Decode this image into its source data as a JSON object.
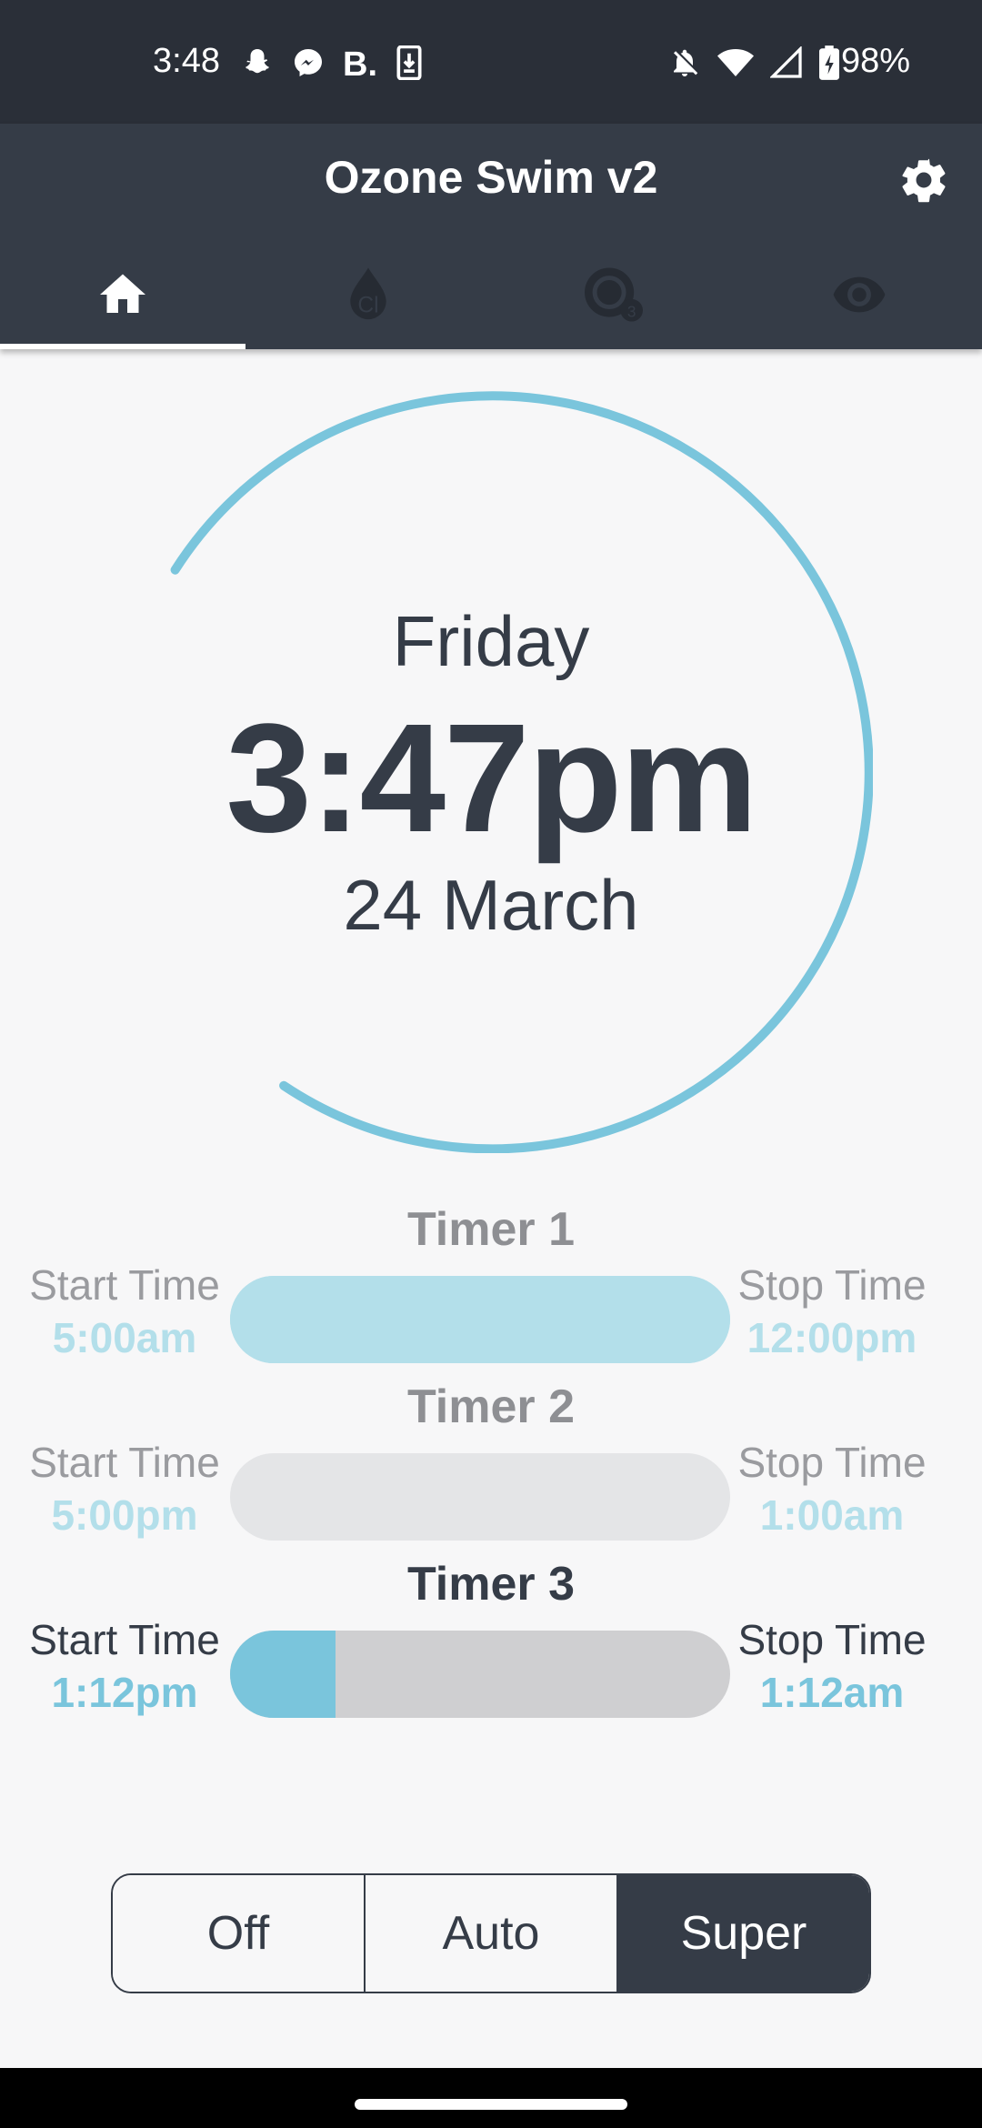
{
  "status_bar": {
    "time": "3:48",
    "battery_percent": "98%",
    "left_icons": [
      "snapchat-icon",
      "messenger-icon",
      "b-icon",
      "download-icon"
    ],
    "right_icons": [
      "notifications-off-icon",
      "wifi-icon",
      "cell-signal-icon",
      "battery-charging-icon"
    ]
  },
  "app_bar": {
    "title": "Ozone Swim v2",
    "settings_icon": "gear-icon",
    "tabs": [
      {
        "icon": "home-icon",
        "active": true
      },
      {
        "icon": "chlorine-drop-icon",
        "active": false
      },
      {
        "icon": "ozone-icon",
        "active": false
      },
      {
        "icon": "eye-icon",
        "active": false
      }
    ]
  },
  "clock": {
    "day": "Friday",
    "time": "3:47pm",
    "date": "24 March",
    "accent_color": "#7ac5dc"
  },
  "timers": [
    {
      "title": "Timer 1",
      "start_label": "Start Time",
      "start_value": "5:00am",
      "stop_label": "Stop Time",
      "stop_value": "12:00pm",
      "state": "inactive",
      "bar_color": "#b3dfea",
      "progress": 1.0
    },
    {
      "title": "Timer 2",
      "start_label": "Start Time",
      "start_value": "5:00pm",
      "stop_label": "Stop Time",
      "stop_value": "1:00am",
      "state": "inactive",
      "bar_color": "#e4e5e7",
      "progress": 0.0
    },
    {
      "title": "Timer 3",
      "start_label": "Start Time",
      "start_value": "1:12pm",
      "stop_label": "Stop Time",
      "stop_value": "1:12am",
      "state": "active",
      "bar_color": "#cfcfd1",
      "fill_color": "#7ac5dc",
      "progress": 0.21
    }
  ],
  "mode": {
    "options": [
      "Off",
      "Auto",
      "Super"
    ],
    "selected": "Super"
  },
  "colors": {
    "status_bar_bg": "#2a2f38",
    "app_bar_bg": "#353c47",
    "background": "#f7f7f8",
    "text_dark": "#353c47",
    "accent": "#7ac5dc"
  }
}
